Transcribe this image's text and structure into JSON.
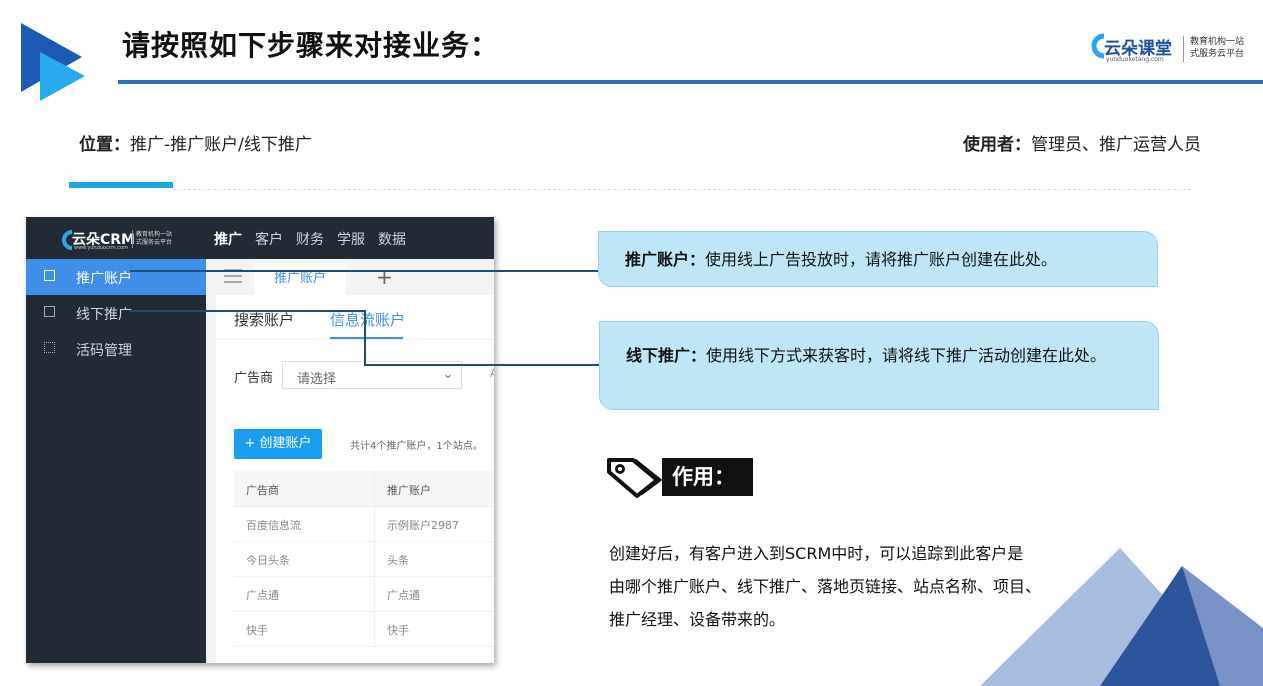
{
  "header": {
    "title": "请按照如下步骤来对接业务：",
    "logo": {
      "name": "云朵课堂",
      "url": "yunduoketang.com",
      "slogan_line1": "教育机构一站",
      "slogan_line2": "式服务云平台"
    }
  },
  "info": {
    "position_label": "位置：",
    "position_value": "推广-推广账户/线下推广",
    "user_label": "使用者：",
    "user_value": "管理员、推广运营人员"
  },
  "crm": {
    "logo": {
      "name": "云朵CRM",
      "url": "www.yunduocrm.com",
      "slogan_line1": "教育机构一站",
      "slogan_line2": "式服务云平台"
    },
    "top_nav": [
      "推广",
      "客户",
      "财务",
      "学服",
      "数据"
    ],
    "sidebar": [
      {
        "label": "推广账户",
        "icon": "account-icon",
        "active": true
      },
      {
        "label": "线下推广",
        "icon": "check-icon",
        "active": false
      },
      {
        "label": "活码管理",
        "icon": "qrcode-icon",
        "active": false
      }
    ],
    "tab_label": "推广账户",
    "tab_add": "+",
    "sub_tabs": [
      "搜索账户",
      "信息流账户"
    ],
    "filter_label": "广告商",
    "filter_placeholder": "请选择",
    "filter_cut": "A",
    "create_button": "+ 创建账户",
    "summary": "共计4个推广账户，1个站点。",
    "table": {
      "headers": [
        "广告商",
        "推广账户"
      ],
      "rows": [
        [
          "百度信息流",
          "示例账户2987"
        ],
        [
          "今日头条",
          "头条"
        ],
        [
          "广点通",
          "广点通"
        ],
        [
          "快手",
          "快手"
        ]
      ]
    }
  },
  "callouts": [
    {
      "label": "推广账户：",
      "text": "使用线上广告投放时，请将推广账户创建在此处。"
    },
    {
      "label": "线下推广：",
      "text": "使用线下方式来获客时，请将线下推广活动创建在此处。"
    }
  ],
  "effect": {
    "label": "作用：",
    "text_line1": "创建好后，有客户进入到SCRM中时，可以追踪到此客户是",
    "text_line2": "由哪个推广账户、线下推广、落地页链接、站点名称、项目、",
    "text_line3": "推广经理、设备带来的。"
  },
  "colors": {
    "primary_blue": "#2f6fbf",
    "accent_cyan": "#17a9e6",
    "callout_bg": "#bfe6f7",
    "sidebar_dark": "#222a35",
    "sidebar_active": "#3f8fe8"
  }
}
